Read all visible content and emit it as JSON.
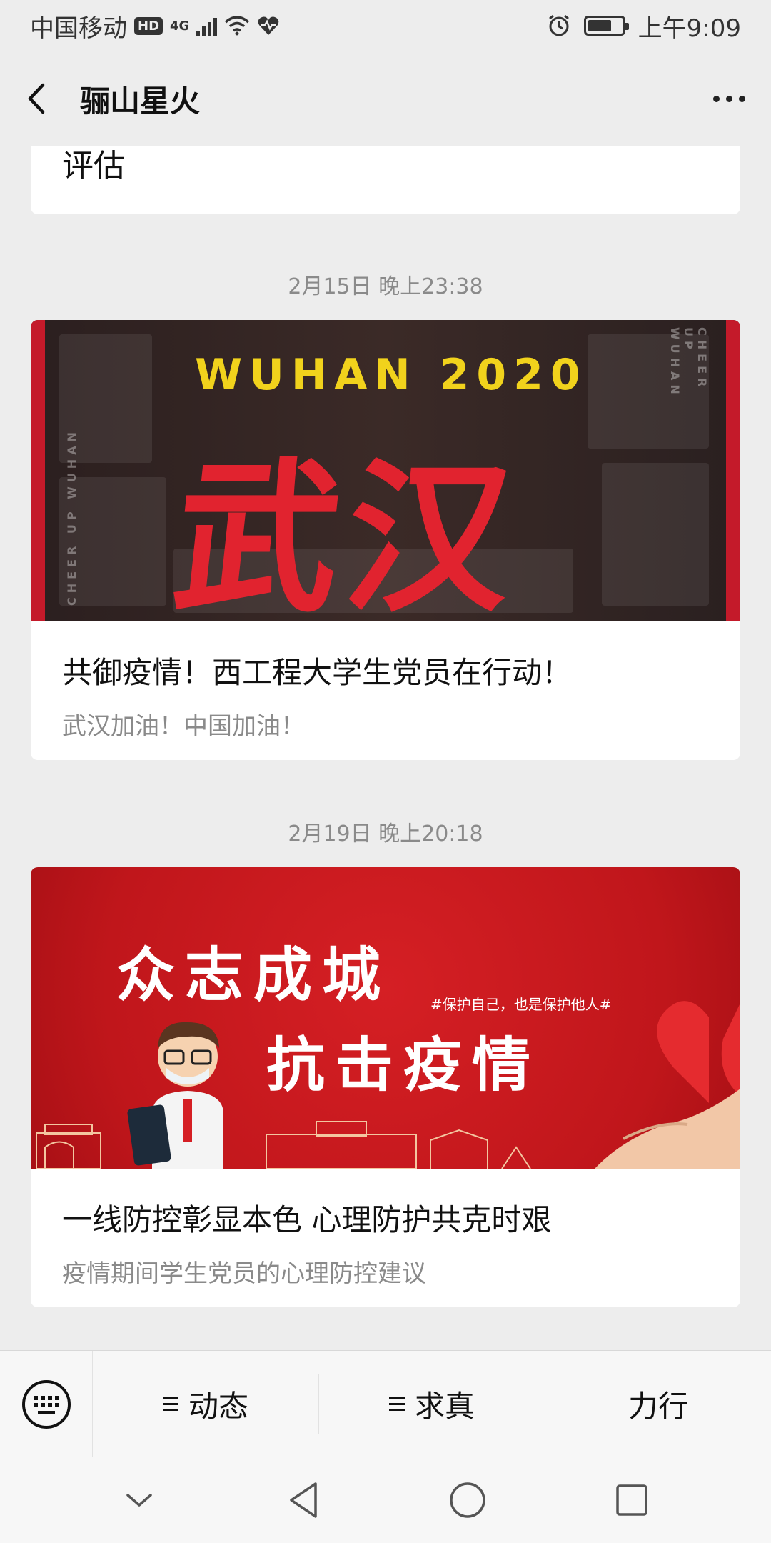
{
  "status_bar": {
    "carrier": "中国移动",
    "hd": "HD",
    "network": "4G",
    "time": "上午9:09",
    "battery_level": 0.7
  },
  "nav": {
    "title": "骊山星火",
    "back_icon": "chevron-left-icon",
    "more_icon": "more-dots-icon"
  },
  "messages": [
    {
      "partial_title": "评估"
    },
    {
      "time": "2月15日 晚上23:38",
      "cover": {
        "headline_en": "WUHAN 2020",
        "headline_cn": "武汉",
        "side_text": "CHEER UP WUHAN"
      },
      "title": "共御疫情！西工程大学生党员在行动！",
      "subtitle": "武汉加油！中国加油！"
    },
    {
      "time": "2月19日 晚上20:18",
      "cover": {
        "line1": "众志成城",
        "line2": "抗击疫情",
        "tag": "#保护自己，也是保护他人#"
      },
      "title": "一线防控彰显本色  心理防护共克时艰",
      "subtitle": "疫情期间学生党员的心理防控建议"
    }
  ],
  "menu": {
    "keyboard_icon": "keyboard-icon",
    "items": [
      {
        "label": "动态",
        "has_submenu": true
      },
      {
        "label": "求真",
        "has_submenu": true
      },
      {
        "label": "力行",
        "has_submenu": false
      }
    ]
  },
  "system_nav": [
    "collapse-icon",
    "back-triangle-icon",
    "home-circle-icon",
    "recents-square-icon"
  ]
}
